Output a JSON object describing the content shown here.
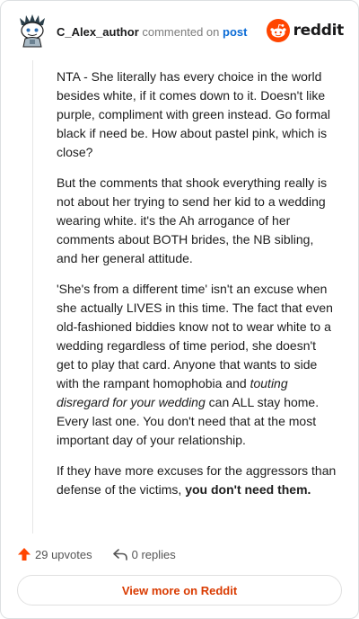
{
  "header": {
    "author": "C_Alex_author",
    "commented_on": "commented on",
    "post_link": "post",
    "brand": "reddit"
  },
  "comment": {
    "p1": "NTA - She literally has every choice in the world besides white, if it comes down to it. Doesn't like purple, compliment with green instead. Go formal black if need be. How about pastel pink, which is close?",
    "p2": "But the comments that shook everything really is not about her trying to send her kid to a wedding wearing white. it's the Ah arrogance of her comments about BOTH brides, the NB sibling, and her general attitude.",
    "p3_a": "'She's from a different time' isn't an excuse when she actually LIVES in this time. The fact that even old-fashioned biddies know not to wear white to a wedding regardless of time period, she doesn't get to play that card. Anyone that wants to side with the rampant homophobia and ",
    "p3_em": "touting disregard for your wedding",
    "p3_b": " can ALL stay home. Every last one. You don't need that at the most important day of your relationship.",
    "p4_a": "If they have more excuses for the aggressors than defense of the victims, ",
    "p4_strong": "you don't need them."
  },
  "actions": {
    "upvotes": "29 upvotes",
    "replies": "0 replies"
  },
  "footer": {
    "view_more": "View more on Reddit"
  },
  "colors": {
    "brand_orange": "#ff4500",
    "link_blue": "#0a6bd6",
    "view_more_text": "#d93a00"
  },
  "icons": {
    "avatar": "snoo-avatar",
    "brand": "reddit-logo-icon",
    "upvote": "upvote-arrow-icon",
    "reply": "reply-arrow-icon"
  }
}
